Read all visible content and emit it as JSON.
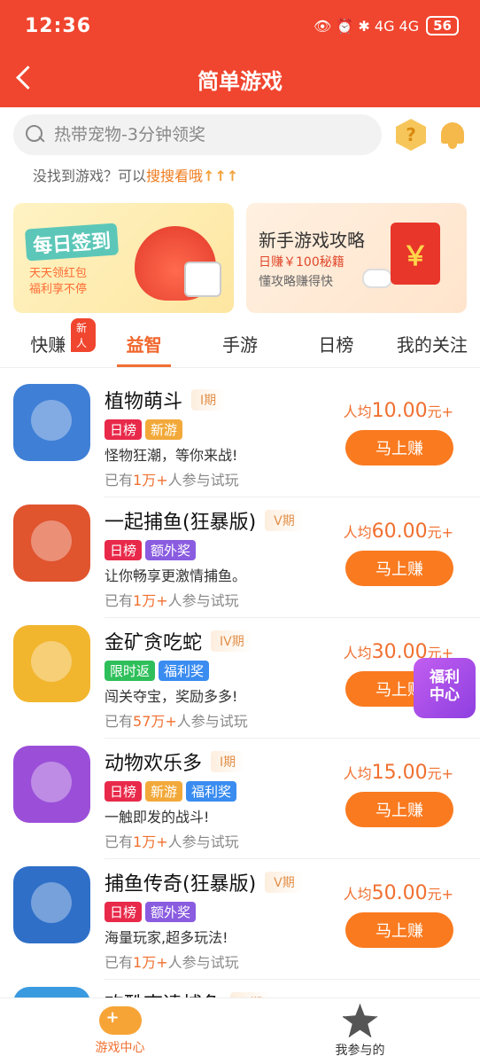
{
  "status_bar": {
    "time": "12:36",
    "icons": "👁 ⏰ ✱ 4G 4G",
    "battery": "56"
  },
  "header": {
    "title": "简单游戏"
  },
  "search": {
    "placeholder": "热带宠物-3分钟领奖",
    "hint_prefix": "没找到游戏？可以",
    "hint_link": "搜搜看哦",
    "hint_arrows": "↑↑↑"
  },
  "banners": {
    "left": {
      "title": "每日签到",
      "line1": "天天领红包",
      "line2": "福利享不停"
    },
    "right": {
      "title": "新手游戏攻略",
      "line1": "日赚￥100秘籍",
      "line2": "懂攻略赚得快",
      "envelope": "￥"
    }
  },
  "tabs": [
    {
      "label": "快赚",
      "badge": "新人"
    },
    {
      "label": "益智"
    },
    {
      "label": "手游"
    },
    {
      "label": "日榜"
    },
    {
      "label": "我的关注"
    }
  ],
  "colors": {
    "tag_ranking": "#e8294a",
    "tag_new": "#f2a93a",
    "tag_bonus": "#8a5ce0",
    "tag_limited": "#2fbf5a",
    "tag_welfare": "#3a8cf0"
  },
  "games": [
    {
      "name": "植物萌斗",
      "period": "I期",
      "tags": [
        {
          "text": "日榜",
          "color": "#e8294a"
        },
        {
          "text": "新游",
          "color": "#f2a93a"
        }
      ],
      "desc": "怪物狂潮，等你来战!",
      "players_prefix": "已有",
      "players_count": "1万+",
      "players_suffix": "人参与试玩",
      "reward_prefix": "人均",
      "reward_amount": "10.00",
      "reward_suffix": "元+",
      "button": "马上赚",
      "icon_color": "#3f7fd6"
    },
    {
      "name": "一起捕鱼(狂暴版)",
      "period": "V期",
      "tags": [
        {
          "text": "日榜",
          "color": "#e8294a"
        },
        {
          "text": "额外奖",
          "color": "#8a5ce0"
        }
      ],
      "desc": "让你畅享更激情捕鱼。",
      "players_prefix": "已有",
      "players_count": "1万+",
      "players_suffix": "人参与试玩",
      "reward_prefix": "人均",
      "reward_amount": "60.00",
      "reward_suffix": "元+",
      "button": "马上赚",
      "icon_color": "#e0542e"
    },
    {
      "name": "金矿贪吃蛇",
      "period": "IV期",
      "tags": [
        {
          "text": "限时返",
          "color": "#2fbf5a"
        },
        {
          "text": "福利奖",
          "color": "#3a8cf0"
        }
      ],
      "desc": "闯关夺宝，奖励多多!",
      "players_prefix": "已有",
      "players_count": "57万+",
      "players_suffix": "人参与试玩",
      "reward_prefix": "人均",
      "reward_amount": "30.00",
      "reward_suffix": "元+",
      "button": "马上赚",
      "icon_color": "#f2b52e"
    },
    {
      "name": "动物欢乐多",
      "period": "I期",
      "tags": [
        {
          "text": "日榜",
          "color": "#e8294a"
        },
        {
          "text": "新游",
          "color": "#f2a93a"
        },
        {
          "text": "福利奖",
          "color": "#3a8cf0"
        }
      ],
      "desc": "一触即发的战斗!",
      "players_prefix": "已有",
      "players_count": "1万+",
      "players_suffix": "人参与试玩",
      "reward_prefix": "人均",
      "reward_amount": "15.00",
      "reward_suffix": "元+",
      "button": "马上赚",
      "icon_color": "#9b4fd8"
    },
    {
      "name": "捕鱼传奇(狂暴版)",
      "period": "V期",
      "tags": [
        {
          "text": "日榜",
          "color": "#e8294a"
        },
        {
          "text": "额外奖",
          "color": "#8a5ce0"
        }
      ],
      "desc": "海量玩家,超多玩法!",
      "players_prefix": "已有",
      "players_count": "1万+",
      "players_suffix": "人参与试玩",
      "reward_prefix": "人均",
      "reward_amount": "50.00",
      "reward_suffix": "元+",
      "button": "马上赚",
      "icon_color": "#2f6fc8"
    },
    {
      "name": "欢酷李逵捕鱼",
      "period": "III期",
      "tags": [],
      "desc": "",
      "players_prefix": "",
      "players_count": "",
      "players_suffix": "",
      "reward_prefix": "",
      "reward_amount": "",
      "reward_suffix": "",
      "button": "",
      "icon_color": "#3a9ae0"
    }
  ],
  "float_badge": {
    "line1": "福利",
    "line2": "中心"
  },
  "bottom_nav": [
    {
      "label": "游戏中心",
      "icon": "gamepad-icon"
    },
    {
      "label": "我参与的",
      "icon": "star-icon"
    }
  ]
}
